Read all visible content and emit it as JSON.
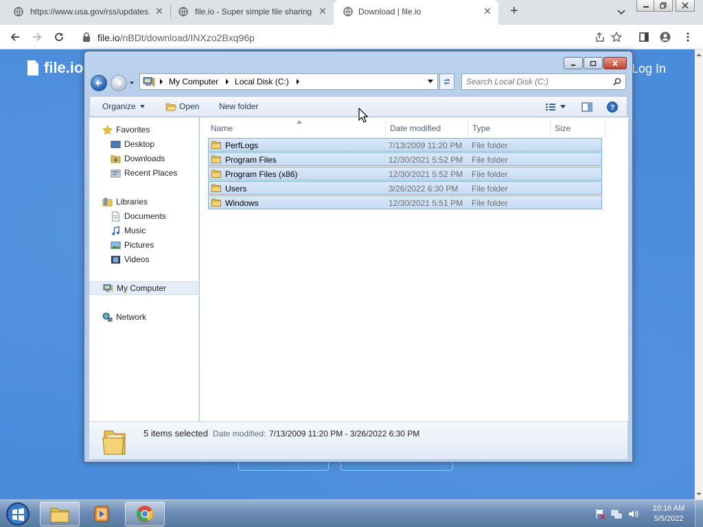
{
  "browser": {
    "tabs": [
      {
        "title": "https://www.usa.gov/rss/updates.xm",
        "active": false
      },
      {
        "title": "file.io - Super simple file sharing",
        "active": false
      },
      {
        "title": "Download | file.io",
        "active": true
      }
    ],
    "url_host": "file.io",
    "url_path": "/nBDt/download/INXzo2Bxq96p"
  },
  "website": {
    "logo_text": "file.io",
    "login_label": "Log In",
    "bg_color": "#4a8cdc"
  },
  "explorer": {
    "breadcrumbs": [
      "My Computer",
      "Local Disk (C:)"
    ],
    "search_placeholder": "Search Local Disk (C:)",
    "commands": {
      "organize": "Organize",
      "open": "Open",
      "new_folder": "New folder"
    },
    "nav": {
      "favorites": "Favorites",
      "desktop": "Desktop",
      "downloads": "Downloads",
      "recent_places": "Recent Places",
      "libraries": "Libraries",
      "documents": "Documents",
      "music": "Music",
      "pictures": "Pictures",
      "videos": "Videos",
      "my_computer": "My Computer",
      "network": "Network"
    },
    "columns": {
      "name": "Name",
      "date_modified": "Date modified",
      "type": "Type",
      "size": "Size"
    },
    "files": [
      {
        "name": "PerfLogs",
        "date": "7/13/2009 11:20 PM",
        "type": "File folder"
      },
      {
        "name": "Program Files",
        "date": "12/30/2021 5:52 PM",
        "type": "File folder"
      },
      {
        "name": "Program Files (x86)",
        "date": "12/30/2021 5:52 PM",
        "type": "File folder"
      },
      {
        "name": "Users",
        "date": "3/26/2022 6:30 PM",
        "type": "File folder"
      },
      {
        "name": "Windows",
        "date": "12/30/2021 5:51 PM",
        "type": "File folder"
      }
    ],
    "details": {
      "count": "5 items selected",
      "date_label": "Date modified:",
      "date_range": "7/13/2009 11:20 PM - 3/26/2022 6:30 PM"
    }
  },
  "taskbar": {
    "time": "10:16 AM",
    "date": "5/5/2022"
  }
}
